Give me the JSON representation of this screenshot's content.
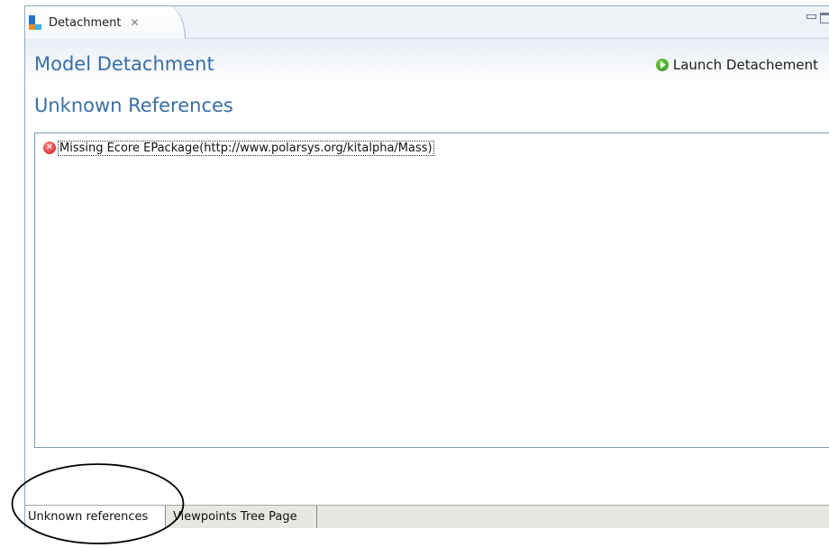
{
  "view_tab": {
    "label": "Detachment",
    "icon": "detachment-view-icon",
    "close_icon": "close-icon"
  },
  "window_controls": {
    "minimize_icon": "minimize-icon",
    "maximize_icon": "maximize-icon"
  },
  "form": {
    "title": "Model Detachment",
    "launch_action": {
      "label": "Launch Detachement",
      "icon": "play-icon"
    }
  },
  "section": {
    "title": "Unknown References"
  },
  "tree": {
    "items": [
      {
        "label": "Missing Ecore EPackage(http://www.polarsys.org/kitalpha/Mass)",
        "icon": "error-icon"
      }
    ]
  },
  "page_tabs": [
    {
      "label": "Unknown references",
      "active": true
    },
    {
      "label": "Viewpoints Tree Page",
      "active": false
    }
  ],
  "colors": {
    "title": "#3a6ea5",
    "frame_border": "#8fa8c8",
    "error": "#c9161c",
    "launch_green": "#2f8a14",
    "annotation": "#000000"
  }
}
